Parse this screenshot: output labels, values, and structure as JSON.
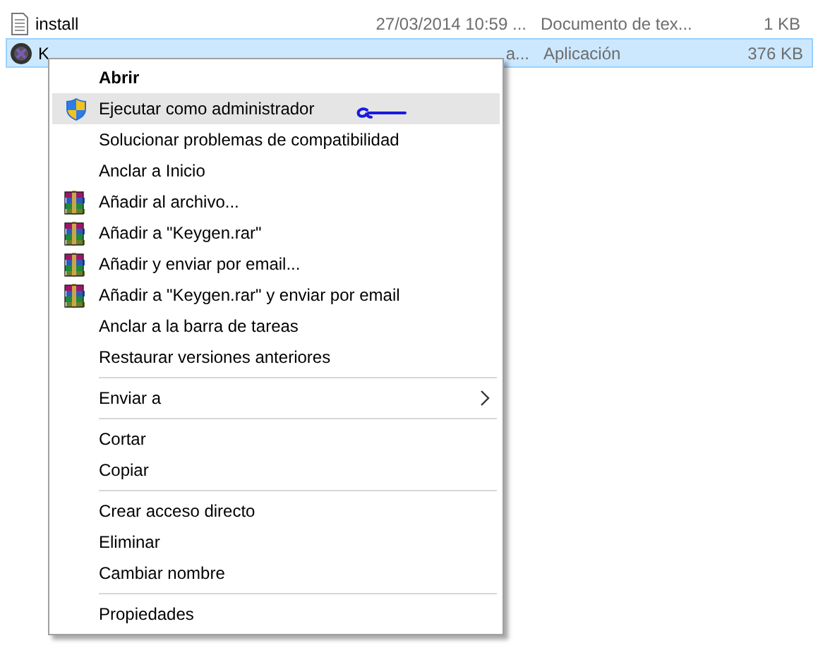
{
  "files": [
    {
      "kind": "document",
      "name": "install",
      "date": "27/03/2014 10:59 ...",
      "type": "Documento de tex...",
      "size": "1 KB",
      "selected": false
    },
    {
      "kind": "application",
      "name": "K",
      "date": "a...",
      "type": "Aplicación",
      "size": "376 KB",
      "selected": true
    }
  ],
  "context_menu": {
    "items": [
      {
        "kind": "default",
        "label": "Abrir",
        "selected": false
      },
      {
        "kind": "shield",
        "label": "Ejecutar como administrador",
        "selected": true
      },
      {
        "kind": "plain",
        "label": "Solucionar problemas de compatibilidad",
        "selected": false
      },
      {
        "kind": "plain",
        "label": "Anclar a Inicio",
        "selected": false
      },
      {
        "kind": "archive",
        "label": "Añadir al archivo...",
        "selected": false
      },
      {
        "kind": "archive",
        "label": "Añadir a \"Keygen.rar\"",
        "selected": false
      },
      {
        "kind": "archive",
        "label": "Añadir y enviar por email...",
        "selected": false
      },
      {
        "kind": "archive",
        "label": "Añadir a \"Keygen.rar\" y enviar por email",
        "selected": false
      },
      {
        "kind": "plain",
        "label": "Anclar a la barra de tareas",
        "selected": false
      },
      {
        "kind": "plain",
        "label": "Restaurar versiones anteriores",
        "selected": false
      },
      {
        "kind": "separator"
      },
      {
        "kind": "submenu",
        "label": "Enviar a",
        "selected": false
      },
      {
        "kind": "separator"
      },
      {
        "kind": "plain",
        "label": "Cortar",
        "selected": false
      },
      {
        "kind": "plain",
        "label": "Copiar",
        "selected": false
      },
      {
        "kind": "separator"
      },
      {
        "kind": "plain",
        "label": "Crear acceso directo",
        "selected": false
      },
      {
        "kind": "plain",
        "label": "Eliminar",
        "selected": false
      },
      {
        "kind": "plain",
        "label": "Cambiar nombre",
        "selected": false
      },
      {
        "kind": "separator"
      },
      {
        "kind": "plain",
        "label": "Propiedades",
        "selected": false
      }
    ]
  },
  "annotation": {
    "kind": "arrow"
  }
}
